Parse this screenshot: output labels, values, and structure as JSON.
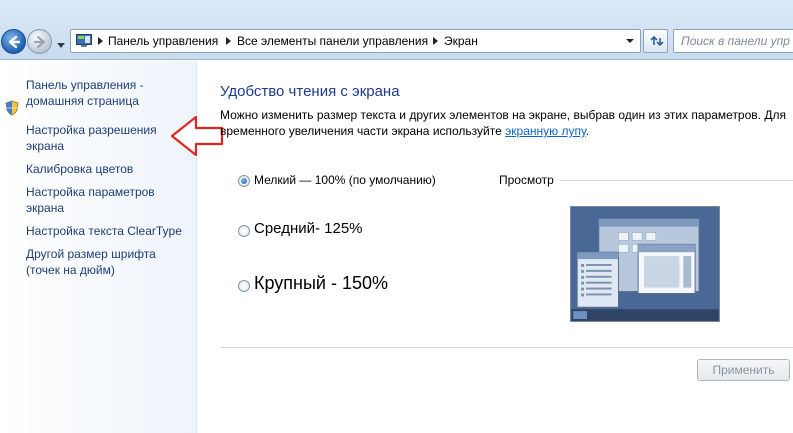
{
  "breadcrumb": {
    "items": [
      "Панель управления",
      "Все элементы панели управления",
      "Экран"
    ]
  },
  "search": {
    "placeholder": "Поиск в панели упр"
  },
  "sidebar": {
    "items": [
      {
        "label": "Панель управления - домашняя страница"
      },
      {
        "label": "Настройка разрешения экрана"
      },
      {
        "label": "Калибровка цветов"
      },
      {
        "label": "Настройка параметров экрана"
      },
      {
        "label": "Настройка текста ClearType"
      },
      {
        "label": "Другой размер шрифта (точек на дюйм)"
      }
    ]
  },
  "main": {
    "title": "Удобство чтения с экрана",
    "description": "Можно изменить размер текста и других элементов на экране, выбрав один из этих параметров. Для временного увеличения части экрана используйте",
    "description_link": "экранную лупу",
    "description_end": ".",
    "options": [
      {
        "label": "Мелкий — 100% (по умолчанию)",
        "checked": true
      },
      {
        "label": "Средний- 125%",
        "checked": false
      },
      {
        "label": "Крупный - 150%",
        "checked": false
      }
    ],
    "preview_label": "Просмотр",
    "apply_label": "Применить"
  },
  "colors": {
    "accent": "#1e3a8a",
    "link": "#0d63c7",
    "arrow": "#e0261e"
  },
  "icons": [
    "back-arrow-icon",
    "forward-arrow-icon",
    "control-panel-icon",
    "refresh-icon",
    "shield-icon",
    "red-arrow-annotation"
  ]
}
